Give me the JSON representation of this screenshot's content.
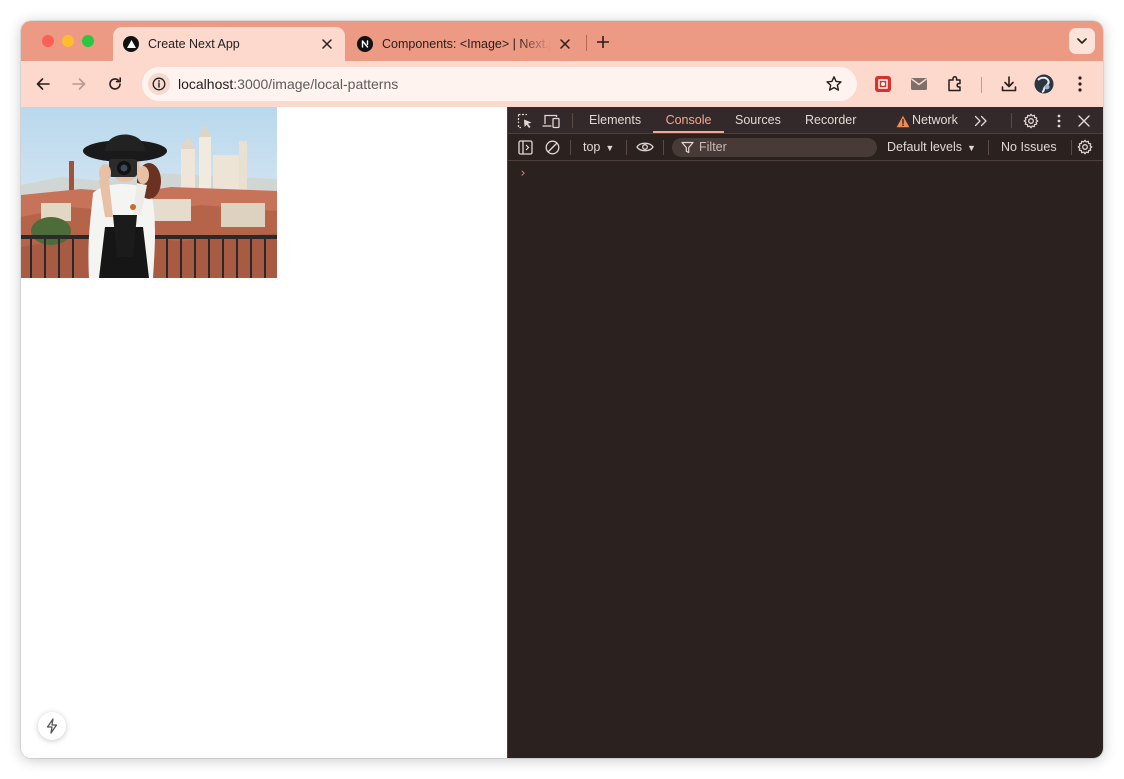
{
  "browser": {
    "tabs": [
      {
        "title": "Create Next App",
        "active": true,
        "favicon": "triangle-logo-icon"
      },
      {
        "title": "Components: <Image> | Next.js",
        "active": false,
        "favicon": "nextjs-n-icon"
      }
    ],
    "address": {
      "host": "localhost",
      "path": ":3000/image/local-patterns"
    }
  },
  "page": {
    "image": {
      "description": "woman-with-camera-photo"
    }
  },
  "devtools": {
    "tabs": [
      "Elements",
      "Console",
      "Sources",
      "Recorder",
      "Network"
    ],
    "active_tab": "Console",
    "console": {
      "context": "top",
      "filter_placeholder": "Filter",
      "levels": "Default levels",
      "issues": "No Issues",
      "prompt": "›"
    }
  },
  "colors": {
    "tabstrip": "#ec9a83",
    "toolbar": "#fcd8cd",
    "devtools_bg": "#2b2220",
    "devtools_accent": "#f7a78f",
    "warning": "#f28b54"
  }
}
